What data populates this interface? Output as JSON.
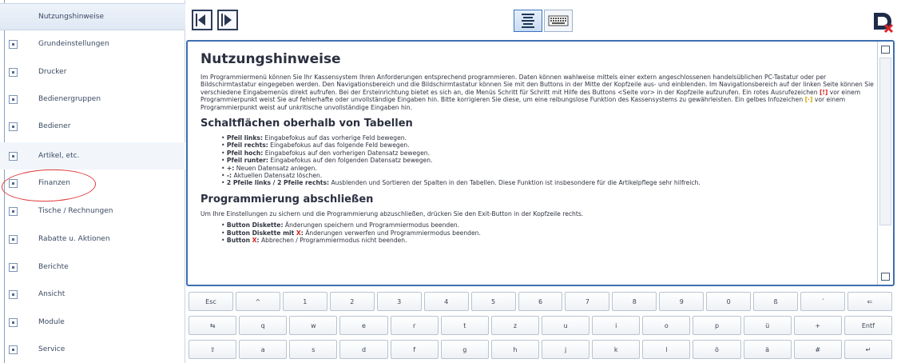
{
  "sidebar": {
    "items": [
      {
        "label": "Nutzungshinweise",
        "expander": false,
        "state": "active"
      },
      {
        "label": "Grundeinstellungen",
        "expander": true
      },
      {
        "label": "Drucker",
        "expander": true
      },
      {
        "label": "Bedienergruppen",
        "expander": true
      },
      {
        "label": "Bediener",
        "expander": true
      },
      {
        "label": "Artikel, etc.",
        "expander": true,
        "state": "highlight"
      },
      {
        "label": "Finanzen",
        "expander": true,
        "annotated": true
      },
      {
        "label": "Tische / Rechnungen",
        "expander": true
      },
      {
        "label": "Rabatte u. Aktionen",
        "expander": true
      },
      {
        "label": "Berichte",
        "expander": true
      },
      {
        "label": "Ansicht",
        "expander": true
      },
      {
        "label": "Module",
        "expander": true
      },
      {
        "label": "Service",
        "expander": true
      }
    ]
  },
  "toolbar": {
    "icons": [
      "arrow-left-icon",
      "arrow-right-icon",
      "text-view-icon",
      "keyboard-view-icon",
      "exit-icon"
    ]
  },
  "doc": {
    "title": "Nutzungshinweise",
    "intro_a": "Im Programmiermenü können Sie Ihr Kassensystem Ihren Anforderungen entsprechend programmieren. Daten können wahlweise mittels einer extern angeschlossenen handelsüblichen PC-Tastatur oder per Bildschirmtastatur eingegeben werden. Den Navigationsbereich und die Bildschirmtastatur können Sie mit den Buttons in der Mitte der Kopfzeile aus- und einblenden. Im Navigationsbereich auf der linken Seite können Sie verschiedene Eingabemenüs direkt aufrufen. Bei der Ersteinrichtung bietet es sich an, die Menüs Schritt für Schritt mit Hilfe des Buttons <Seite vor> in der Kopfzeile aufzurufen. Ein rotes Ausrufezeichen ",
    "excl": "[!]",
    "intro_b": " vor einem Programmierpunkt weist Sie auf fehlerhafte oder unvollständige Eingaben hin. Bitte korrigieren Sie diese, um eine reibungslose Funktion des Kassensystems zu gewährleisten. Ein gelbes Infozeichen ",
    "info": "[·]",
    "intro_c": " vor einem Programmierpunkt weist auf unkritische unvollständige Eingaben hin.",
    "section1_title": "Schaltflächen oberhalb von Tabellen",
    "section1_items": [
      {
        "term": "Pfeil links:",
        "text": " Eingabefokus auf das vorherige Feld bewegen."
      },
      {
        "term": "Pfeil rechts:",
        "text": " Eingabefokus auf das folgende Feld bewegen."
      },
      {
        "term": "Pfeil hoch:",
        "text": " Eingabefokus auf den vorherigen Datensatz bewegen."
      },
      {
        "term": "Pfeil runter:",
        "text": " Eingabefokus auf den folgenden Datensatz bewegen."
      },
      {
        "term": "+:",
        "text": " Neuen Datensatz anlegen."
      },
      {
        "term": "-:",
        "text": " Aktuellen Datensatz löschen."
      },
      {
        "term": "2 Pfeile links / 2 Pfeile rechts:",
        "text": " Ausblenden und Sortieren der Spalten in den Tabellen. Diese Funktion ist insbesondere für die Artikelpflege sehr hilfreich."
      }
    ],
    "section2_title": "Programmierung abschließen",
    "section2_text": "Um Ihre Einstellungen zu sichern und die Programmierung abzuschließen, drücken Sie den Exit-Button in der Kopfzeile rechts.",
    "section2_items": [
      {
        "term": "Button Diskette:",
        "mark": "",
        "text": " Änderungen speichern und Programmiermodus beenden."
      },
      {
        "term": "Button Diskette mit ",
        "mark": "X",
        "term2": ":",
        "text": " Änderungen verwerfen und Programmiermodus beenden."
      },
      {
        "term": "Button ",
        "mark": "X",
        "term2": ":",
        "text": " Abbrechen / Programmiermodus nicht beenden."
      }
    ]
  },
  "keyboard": {
    "row1": [
      "Esc",
      "^",
      "1",
      "2",
      "3",
      "4",
      "5",
      "6",
      "7",
      "8",
      "9",
      "0",
      "ß",
      "´",
      "⇐"
    ],
    "row2": [
      "⇆",
      "q",
      "w",
      "e",
      "r",
      "t",
      "z",
      "u",
      "i",
      "o",
      "p",
      "ü",
      "+",
      "Entf"
    ],
    "row3": [
      "⇪",
      "a",
      "s",
      "d",
      "f",
      "g",
      "h",
      "j",
      "k",
      "l",
      "ö",
      "ä",
      "#",
      "↵"
    ]
  },
  "colors": {
    "accent": "#3d6eb0",
    "annotation": "#e0383b",
    "error_mark": "#d8241f",
    "info_mark": "#d6a400"
  }
}
